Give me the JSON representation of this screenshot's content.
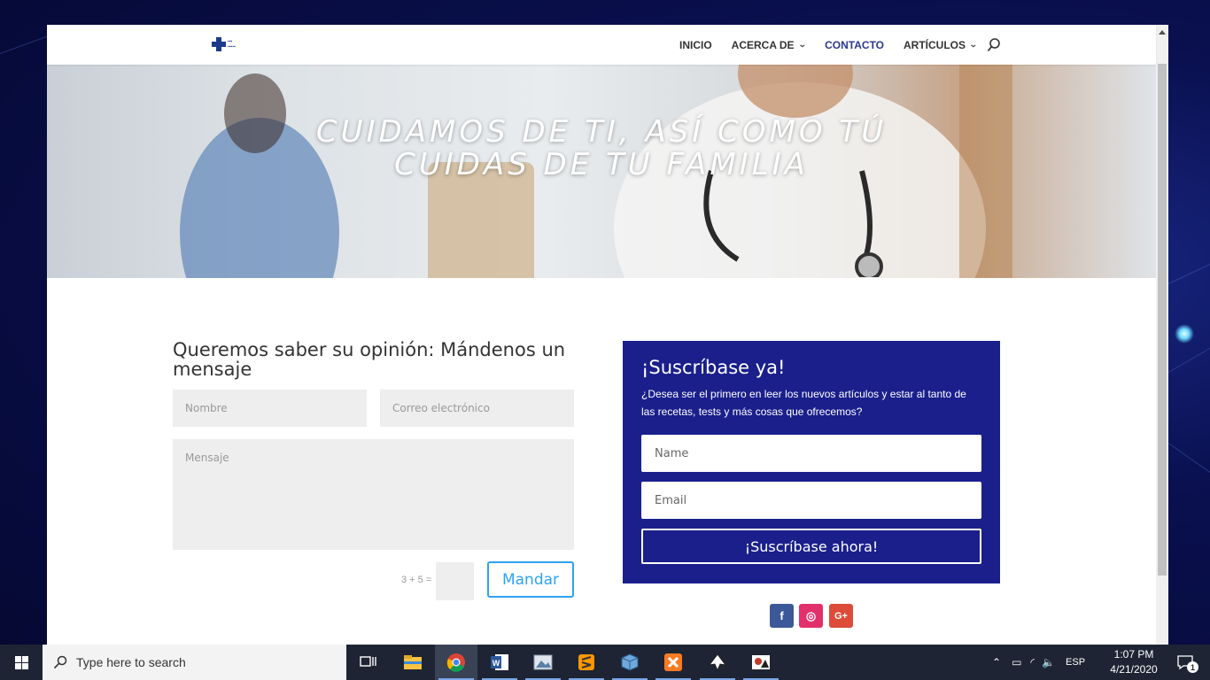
{
  "nav": {
    "items": [
      {
        "label": "INICIO",
        "has_dropdown": false,
        "active": false
      },
      {
        "label": "ACERCA DE",
        "has_dropdown": true,
        "active": false
      },
      {
        "label": "CONTACTO",
        "has_dropdown": false,
        "active": true
      },
      {
        "label": "ARTÍCULOS",
        "has_dropdown": true,
        "active": false
      }
    ],
    "search_icon": "search-icon"
  },
  "hero": {
    "line1": "CUIDAMOS DE TI, ASÍ COMO TÚ",
    "line2": "CUIDAS DE TU FAMILIA"
  },
  "contact": {
    "title": "Queremos saber su opinión: Mándenos un mensaje",
    "name_placeholder": "Nombre",
    "email_placeholder": "Correo electrónico",
    "message_placeholder": "Mensaje",
    "captcha_label": "3 + 5 =",
    "submit_label": "Mandar"
  },
  "subscribe": {
    "title": "¡Suscríbase ya!",
    "description": "¿Desea ser el primero en leer los nuevos artículos y estar al tanto de las recetas, tests y más cosas que ofrecemos?",
    "name_placeholder": "Name",
    "email_placeholder": "Email",
    "button_label": "¡Suscríbase ahora!",
    "background_color": "#1a1f8c"
  },
  "social": [
    {
      "icon": "facebook-icon",
      "glyph": "f",
      "color": "#3b5998"
    },
    {
      "icon": "instagram-icon",
      "glyph": "◎",
      "color": "#e1306c"
    },
    {
      "icon": "google-plus-icon",
      "glyph": "G+",
      "color": "#dd4b39"
    }
  ],
  "taskbar": {
    "search_placeholder": "Type here to search",
    "apps": [
      "task-view-icon",
      "file-explorer-icon",
      "chrome-icon",
      "word-icon",
      "photos-icon",
      "sublime-text-icon",
      "virtualbox-icon",
      "xampp-icon",
      "inkscape-icon",
      "photo-editor-icon"
    ],
    "language": "ESP",
    "time": "1:07 PM",
    "date": "4/21/2020",
    "notification_count": "1"
  }
}
